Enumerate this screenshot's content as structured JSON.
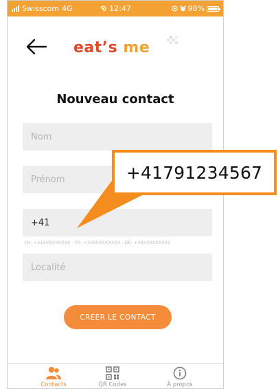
{
  "status_bar": {
    "carrier": "Swisscom",
    "network": "4G",
    "time": "12:47",
    "battery": "98%",
    "battery_level": 0.98
  },
  "header": {
    "logo_part1": "eat’s ",
    "logo_part2": "me"
  },
  "page": {
    "title": "Nouveau contact"
  },
  "form": {
    "nom_placeholder": "Nom",
    "prenom_placeholder": "Prénom",
    "phone_value": "+41",
    "phone_hint": "CH: +41XXXXXXXXX - FR: +33XXXXXXXXX - DE: +49XXXXXXXXX",
    "localite_placeholder": "Localité",
    "create_label": "CRÉER LE CONTACT"
  },
  "bottom_nav": {
    "items": [
      {
        "label": "Contacts",
        "icon": "contacts-icon",
        "active": true
      },
      {
        "label": "QR Codes",
        "icon": "qr-code-icon",
        "active": false
      },
      {
        "label": "À propos",
        "icon": "info-icon",
        "active": false
      }
    ]
  },
  "callout": {
    "text": "+41791234567"
  },
  "colors": {
    "accent": "#f4a233",
    "button": "#f58c3b",
    "logo_red": "#e0492a"
  }
}
